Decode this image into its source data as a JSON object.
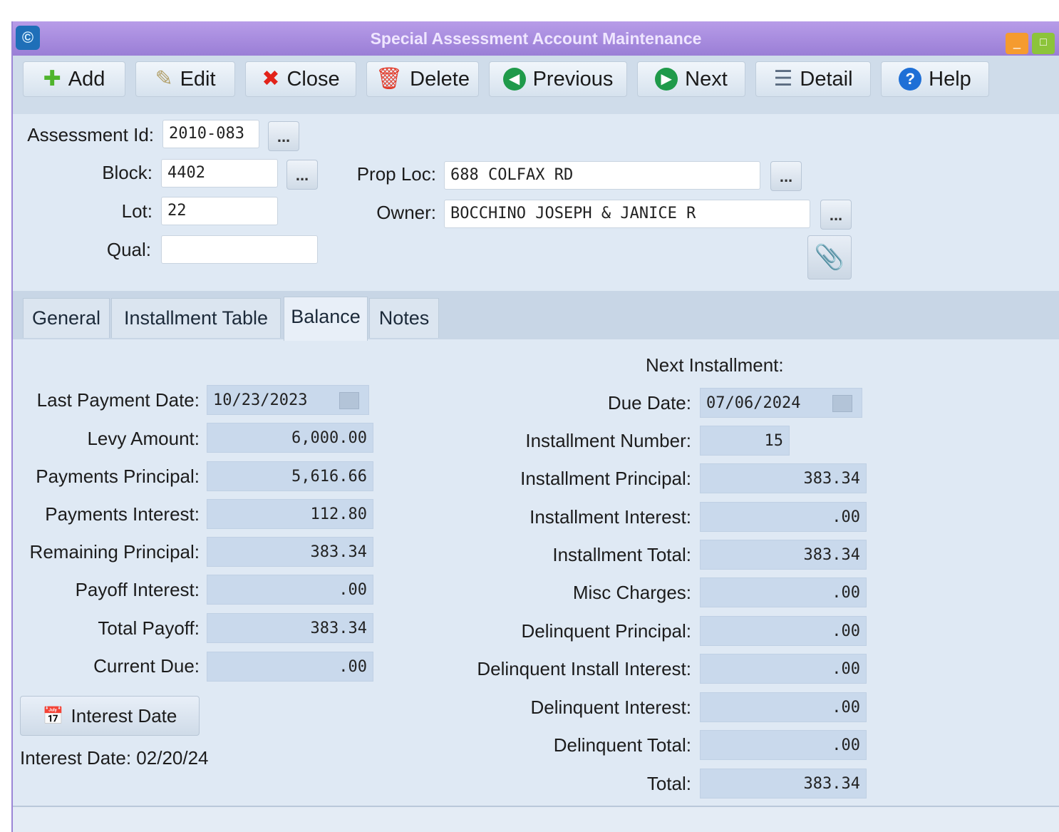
{
  "window": {
    "title": "Special Assessment Account Maintenance"
  },
  "toolbar": {
    "add": "Add",
    "edit": "Edit",
    "close": "Close",
    "delete": "Delete",
    "previous": "Previous",
    "next": "Next",
    "detail": "Detail",
    "help": "Help"
  },
  "header": {
    "assessment_id_label": "Assessment Id:",
    "assessment_id": "2010-083",
    "block_label": "Block:",
    "block": "4402",
    "lot_label": "Lot:",
    "lot": "22",
    "qual_label": "Qual:",
    "qual": "",
    "prop_loc_label": "Prop Loc:",
    "prop_loc": "688 COLFAX RD",
    "owner_label": "Owner:",
    "owner": "BOCCHINO JOSEPH & JANICE R",
    "browse": "..."
  },
  "tabs": [
    "General",
    "Installment Table",
    "Balance",
    "Notes"
  ],
  "balance": {
    "last_payment_date_label": "Last Payment Date:",
    "last_payment_date": "10/23/2023",
    "levy_amount_label": "Levy Amount:",
    "levy_amount": "6,000.00",
    "payments_principal_label": "Payments Principal:",
    "payments_principal": "5,616.66",
    "payments_interest_label": "Payments Interest:",
    "payments_interest": "112.80",
    "remaining_principal_label": "Remaining Principal:",
    "remaining_principal": "383.34",
    "payoff_interest_label": "Payoff Interest:",
    "payoff_interest": ".00",
    "total_payoff_label": "Total Payoff:",
    "total_payoff": "383.34",
    "current_due_label": "Current Due:",
    "current_due": ".00",
    "interest_date_button": "Interest Date",
    "interest_date_text": "Interest Date: 02/20/24"
  },
  "next_installment": {
    "heading": "Next Installment:",
    "due_date_label": "Due Date:",
    "due_date": "07/06/2024",
    "installment_number_label": "Installment Number:",
    "installment_number": "15",
    "installment_principal_label": "Installment Principal:",
    "installment_principal": "383.34",
    "installment_interest_label": "Installment Interest:",
    "installment_interest": ".00",
    "installment_total_label": "Installment Total:",
    "installment_total": "383.34",
    "misc_charges_label": "Misc Charges:",
    "misc_charges": ".00",
    "delinquent_principal_label": "Delinquent Principal:",
    "delinquent_principal": ".00",
    "delinquent_install_interest_label": "Delinquent Install Interest:",
    "delinquent_install_interest": ".00",
    "delinquent_interest_label": "Delinquent Interest:",
    "delinquent_interest": ".00",
    "delinquent_total_label": "Delinquent Total:",
    "delinquent_total": ".00",
    "total_label": "Total:",
    "total": "383.34"
  }
}
